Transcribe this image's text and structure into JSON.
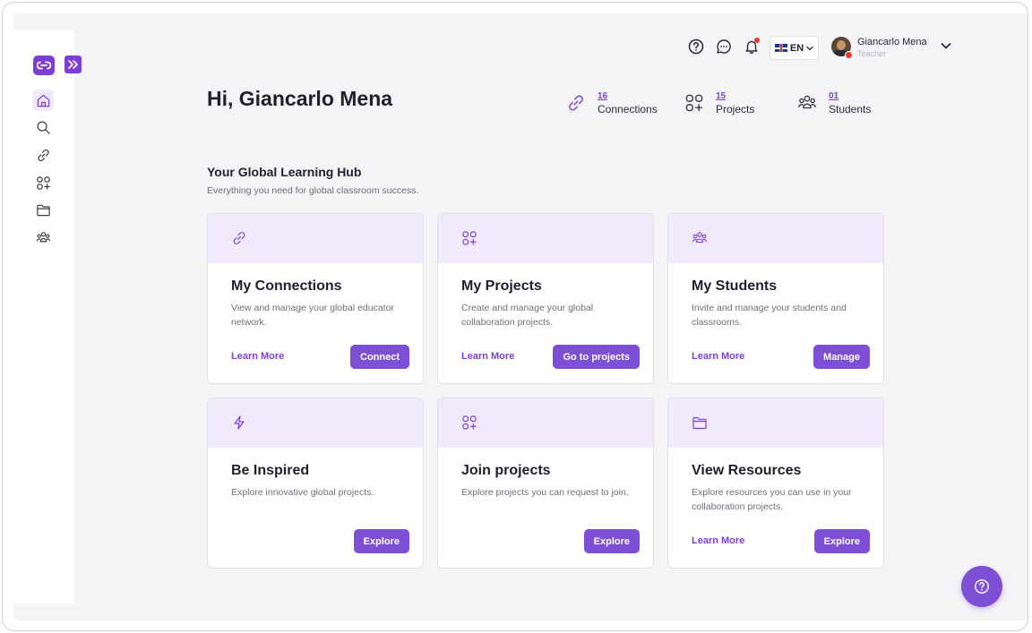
{
  "colors": {
    "accent": "#7c3fd6",
    "card_header_bg": "#f0eafc",
    "canvas_bg": "#f4f4f6",
    "alert": "#e53935"
  },
  "sidebar": {
    "items": [
      {
        "icon": "home-icon",
        "active": true
      },
      {
        "icon": "search-icon",
        "active": false
      },
      {
        "icon": "link-icon",
        "active": false
      },
      {
        "icon": "apps-add-icon",
        "active": false
      },
      {
        "icon": "folder-icon",
        "active": false
      },
      {
        "icon": "users-icon",
        "active": false
      }
    ]
  },
  "topbar": {
    "language": "EN",
    "user": {
      "name": "Giancarlo Mena",
      "role": "Teacher"
    }
  },
  "greeting": "Hi, Giancarlo Mena",
  "stats": [
    {
      "value": "16",
      "label": "Connections",
      "icon": "link-icon"
    },
    {
      "value": "15",
      "label": "Projects",
      "icon": "apps-add-icon"
    },
    {
      "value": "01",
      "label": "Students",
      "icon": "users-icon"
    }
  ],
  "hub": {
    "title": "Your Global Learning Hub",
    "subtitle": "Everything you need for global classroom success."
  },
  "cards": [
    {
      "icon": "link-icon",
      "title": "My Connections",
      "desc": "View and manage your global educator network.",
      "link": "Learn More",
      "button": "Connect"
    },
    {
      "icon": "apps-add-icon",
      "title": "My Projects",
      "desc": "Create and manage your global collaboration projects.",
      "link": "Learn More",
      "button": "Go to projects"
    },
    {
      "icon": "users-icon",
      "title": "My Students",
      "desc": "Invite and manage your students and classrooms.",
      "link": "Learn More",
      "button": "Manage"
    },
    {
      "icon": "bolt-icon",
      "title": "Be Inspired",
      "desc": "Explore innovative global projects.",
      "link": "",
      "button": "Explore"
    },
    {
      "icon": "apps-add-icon",
      "title": "Join projects",
      "desc": "Explore projects you can request to join.",
      "link": "",
      "button": "Explore"
    },
    {
      "icon": "folder-icon",
      "title": "View Resources",
      "desc": "Explore resources you can use in your collaboration projects.",
      "link": "Learn More",
      "button": "Explore"
    }
  ]
}
